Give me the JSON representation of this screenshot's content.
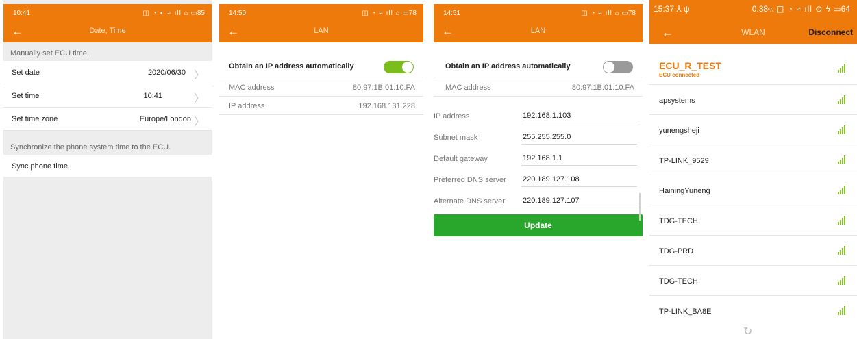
{
  "screen1": {
    "status_time": "10:41",
    "status_icons": "◫ ◔ ◐ ≈ ıll ⌂",
    "battery": "85",
    "title": "Date, Time",
    "caption_manual": "Manually set ECU time.",
    "rows": [
      {
        "label": "Set date",
        "value": "2020/06/30"
      },
      {
        "label": "Set time",
        "value": "10:41"
      },
      {
        "label": "Set time zone",
        "value": "Europe/London"
      }
    ],
    "caption_sync": "Synchronize the phone system time to the ECU.",
    "sync_label": "Sync phone time"
  },
  "screen2": {
    "status_time": "14:50",
    "status_icons": "◫ ◔ ≈ ıll ⌂",
    "battery": "78",
    "title": "LAN",
    "auto_label": "Obtain an IP address automatically",
    "auto_on": true,
    "mac_label": "MAC address",
    "mac_value": "80:97:1B:01:10:FA",
    "ip_label": "IP address",
    "ip_value": "192.168.131.228"
  },
  "screen3": {
    "status_time": "14:51",
    "status_icons": "◫ ◔ ≈ ıll ⌂",
    "battery": "78",
    "title": "LAN",
    "auto_label": "Obtain an IP address automatically",
    "auto_on": false,
    "mac_label": "MAC address",
    "mac_value": "80:97:1B:01:10:FA",
    "fields": [
      {
        "label": "IP address",
        "value": "192.168.1.103"
      },
      {
        "label": "Subnet mask",
        "value": "255.255.255.0"
      },
      {
        "label": "Default gateway",
        "value": "192.168.1.1"
      },
      {
        "label": "Preferred DNS server",
        "value": "220.189.127.108"
      },
      {
        "label": "Alternate DNS server",
        "value": "220.189.127.107"
      }
    ],
    "update_label": "Update"
  },
  "screen4": {
    "status_time": "15:37",
    "status_left_icons": "⅄ ψ",
    "status_speed": "0.38",
    "status_icons": "◫ ◔ ≈ ıll ⊙ ϟ",
    "battery": "64",
    "title": "WLAN",
    "action_label": "Disconnect",
    "networks": [
      {
        "ssid": "ECU_R_TEST",
        "sub": "ECU connected",
        "connected": true
      },
      {
        "ssid": "apsystems"
      },
      {
        "ssid": "yunengsheji"
      },
      {
        "ssid": "TP-LINK_9529"
      },
      {
        "ssid": "HainingYuneng"
      },
      {
        "ssid": "TDG-TECH"
      },
      {
        "ssid": "TDG-PRD"
      },
      {
        "ssid": "TDG-TECH"
      },
      {
        "ssid": "TP-LINK_BA8E"
      }
    ],
    "signal_color": "#86c232",
    "accent": "#ef7a0c"
  }
}
